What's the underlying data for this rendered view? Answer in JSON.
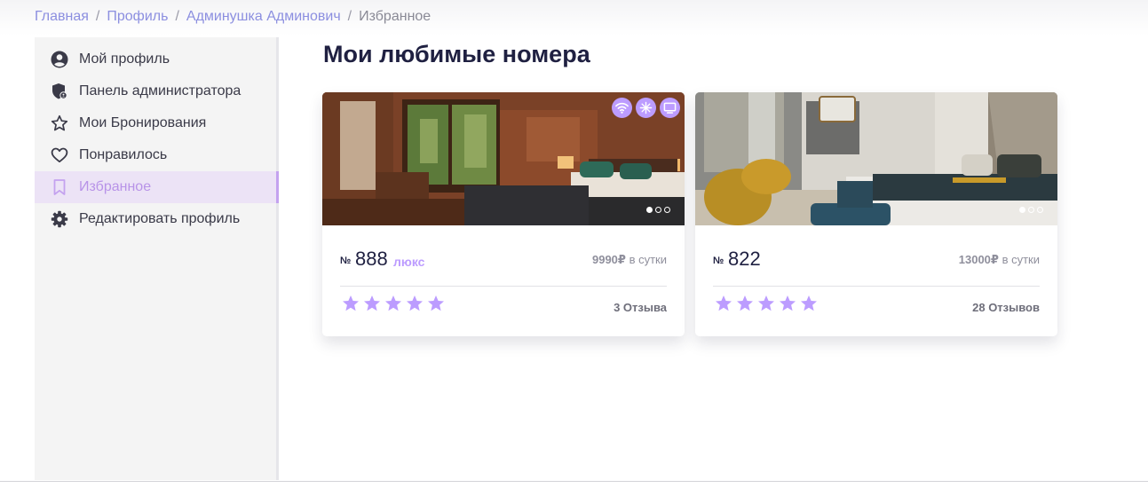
{
  "breadcrumb": {
    "items": [
      "Главная",
      "Профиль",
      "Админушка Админович"
    ],
    "current": "Избранное",
    "separator": "/"
  },
  "sidebar": {
    "items": [
      {
        "label": "Мой профиль",
        "icon": "user-circle-icon"
      },
      {
        "label": "Панель администратора",
        "icon": "admin-shield-icon"
      },
      {
        "label": "Мои Бронирования",
        "icon": "star-outline-icon"
      },
      {
        "label": "Понравилось",
        "icon": "heart-outline-icon"
      },
      {
        "label": "Избранное",
        "icon": "bookmark-icon",
        "active": true
      },
      {
        "label": "Редактировать профиль",
        "icon": "gear-icon"
      }
    ]
  },
  "main": {
    "title": "Мои любимые номера",
    "cards": [
      {
        "number_sign": "№",
        "number": "888",
        "type": "люкс",
        "price": "9990₽",
        "price_unit": "в сутки",
        "rating": 5,
        "reviews": "3 Отзыва",
        "features": [
          "wifi-icon",
          "snowflake-icon",
          "tv-icon"
        ],
        "slides": 3,
        "active_slide": 1
      },
      {
        "number_sign": "№",
        "number": "822",
        "type": "",
        "price": "13000₽",
        "price_unit": "в сутки",
        "rating": 5,
        "reviews": "28 Отзывов",
        "features": [],
        "slides": 3,
        "active_slide": 1
      }
    ]
  },
  "colors": {
    "accent": "#bc9cff",
    "link": "#8c8fe0",
    "dark": "#1f2041",
    "star": "#bc9cff"
  }
}
